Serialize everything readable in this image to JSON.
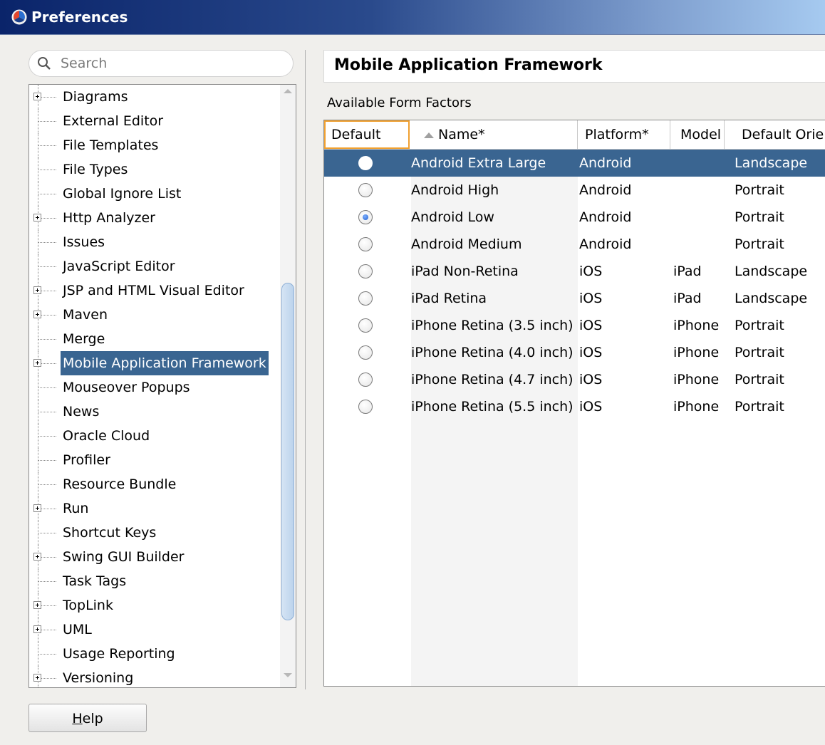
{
  "window": {
    "title": "Preferences"
  },
  "search": {
    "placeholder": "Search",
    "value": ""
  },
  "tree": {
    "items": [
      {
        "label": "Diagrams",
        "expandable": true
      },
      {
        "label": "External Editor",
        "expandable": false
      },
      {
        "label": "File Templates",
        "expandable": false
      },
      {
        "label": "File Types",
        "expandable": false
      },
      {
        "label": "Global Ignore List",
        "expandable": false
      },
      {
        "label": "Http Analyzer",
        "expandable": true
      },
      {
        "label": "Issues",
        "expandable": false
      },
      {
        "label": "JavaScript Editor",
        "expandable": false
      },
      {
        "label": "JSP and HTML Visual Editor",
        "expandable": true
      },
      {
        "label": "Maven",
        "expandable": true
      },
      {
        "label": "Merge",
        "expandable": false
      },
      {
        "label": "Mobile Application Framework",
        "expandable": true,
        "selected": true
      },
      {
        "label": "Mouseover Popups",
        "expandable": false
      },
      {
        "label": "News",
        "expandable": false
      },
      {
        "label": "Oracle Cloud",
        "expandable": false
      },
      {
        "label": "Profiler",
        "expandable": false
      },
      {
        "label": "Resource Bundle",
        "expandable": false
      },
      {
        "label": "Run",
        "expandable": true
      },
      {
        "label": "Shortcut Keys",
        "expandable": false
      },
      {
        "label": "Swing GUI Builder",
        "expandable": true
      },
      {
        "label": "Task Tags",
        "expandable": false
      },
      {
        "label": "TopLink",
        "expandable": true
      },
      {
        "label": "UML",
        "expandable": true
      },
      {
        "label": "Usage Reporting",
        "expandable": false
      },
      {
        "label": "Versioning",
        "expandable": true
      }
    ]
  },
  "main": {
    "title": "Mobile Application Framework",
    "section_label": "Available Form Factors",
    "columns": [
      "Default",
      "Name*",
      "Platform*",
      "Model",
      "Default Orie"
    ],
    "rows": [
      {
        "default": false,
        "name": "Android Extra Large",
        "platform": "Android",
        "model": "",
        "orientation": "Landscape",
        "selected": true
      },
      {
        "default": false,
        "name": "Android High",
        "platform": "Android",
        "model": "",
        "orientation": "Portrait"
      },
      {
        "default": true,
        "name": "Android Low",
        "platform": "Android",
        "model": "",
        "orientation": "Portrait"
      },
      {
        "default": false,
        "name": "Android Medium",
        "platform": "Android",
        "model": "",
        "orientation": "Portrait"
      },
      {
        "default": false,
        "name": "iPad Non-Retina",
        "platform": "iOS",
        "model": "iPad",
        "orientation": "Landscape"
      },
      {
        "default": false,
        "name": "iPad Retina",
        "platform": "iOS",
        "model": "iPad",
        "orientation": "Landscape"
      },
      {
        "default": false,
        "name": "iPhone Retina (3.5 inch)",
        "platform": "iOS",
        "model": "iPhone",
        "orientation": "Portrait"
      },
      {
        "default": false,
        "name": "iPhone Retina (4.0 inch)",
        "platform": "iOS",
        "model": "iPhone",
        "orientation": "Portrait"
      },
      {
        "default": false,
        "name": "iPhone Retina (4.7 inch)",
        "platform": "iOS",
        "model": "iPhone",
        "orientation": "Portrait"
      },
      {
        "default": false,
        "name": "iPhone Retina (5.5 inch)",
        "platform": "iOS",
        "model": "iPhone",
        "orientation": "Portrait"
      }
    ]
  },
  "footer": {
    "help_label": "Help",
    "help_mnemonic": "H",
    "help_rest": "elp"
  },
  "colors": {
    "selection": "#3a6591",
    "titlebar_start": "#0a246a",
    "titlebar_end": "#a6caf0",
    "sort_header_outline": "#f0a030"
  },
  "icons": {
    "app": "jdeveloper-app-icon",
    "search": "search-icon",
    "sort": "sort-ascending-icon"
  }
}
